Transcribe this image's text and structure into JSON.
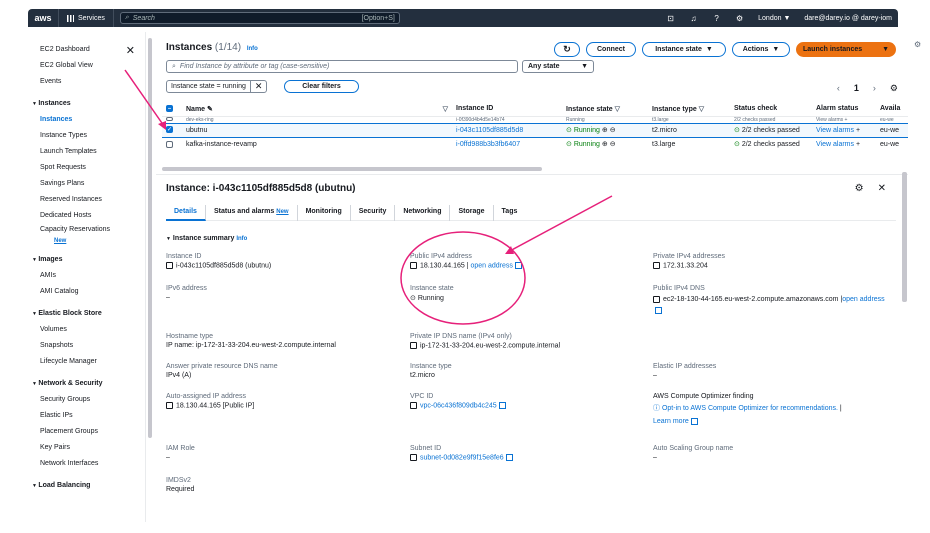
{
  "topnav": {
    "logo": "aws",
    "services_label": "Services",
    "search_placeholder": "Search",
    "search_hint": "[Option+S]",
    "region": "London ▼",
    "account": "dare@darey.io @ darey-iom"
  },
  "sidebar": {
    "top_items": [
      "EC2 Dashboard",
      "EC2 Global View",
      "Events"
    ],
    "sections": [
      {
        "title": "Instances",
        "items": [
          "Instances",
          "Instance Types",
          "Launch Templates",
          "Spot Requests",
          "Savings Plans",
          "Reserved Instances",
          "Dedicated Hosts",
          "Capacity Reservations"
        ],
        "new_label": "New"
      },
      {
        "title": "Images",
        "items": [
          "AMIs",
          "AMI Catalog"
        ]
      },
      {
        "title": "Elastic Block Store",
        "items": [
          "Volumes",
          "Snapshots",
          "Lifecycle Manager"
        ]
      },
      {
        "title": "Network & Security",
        "items": [
          "Security Groups",
          "Elastic IPs",
          "Placement Groups",
          "Key Pairs",
          "Network Interfaces"
        ]
      },
      {
        "title": "Load Balancing",
        "items": []
      }
    ]
  },
  "instances": {
    "title": "Instances",
    "count": "(1/14)",
    "info": "Info",
    "connect": "Connect",
    "instance_state": "Instance state",
    "actions": "Actions",
    "launch": "Launch instances",
    "filter_placeholder": "Find Instance by attribute or tag (case-sensitive)",
    "any_state": "Any state",
    "token": "Instance state = running",
    "clear_filters": "Clear filters",
    "page": "1",
    "columns": [
      "Name",
      "Instance ID",
      "Instance state",
      "Instance type",
      "Status check",
      "Alarm status",
      "Availa"
    ],
    "partial_row": [
      "dev-eks-ring",
      "i-0f390d4b4d5e14b74",
      "Running",
      "t3.large",
      "2/2 checks passed",
      "View alarms +",
      "eu-we"
    ],
    "rows": [
      {
        "name": "ubutnu",
        "id": "i-043c1105df885d5d8",
        "state": "Running",
        "type": "t2.micro",
        "status": "2/2 checks passed",
        "alarm": "View alarms",
        "az": "eu-we"
      },
      {
        "name": "kafka-instance-revamp",
        "id": "i-0ffd988b3b3fb6407",
        "state": "Running",
        "type": "t3.large",
        "status": "2/2 checks passed",
        "alarm": "View alarms",
        "az": "eu-we"
      }
    ]
  },
  "detail": {
    "title": "Instance: i-043c1105df885d5d8 (ubutnu)",
    "tabs": [
      "Details",
      "Status and alarms",
      "Monitoring",
      "Security",
      "Networking",
      "Storage",
      "Tags"
    ],
    "tab_new": "New",
    "summary": "Instance summary",
    "summary_info": "Info",
    "instance_id_label": "Instance ID",
    "instance_id_value": "i-043c1105df885d5d8 (ubutnu)",
    "ipv6_label": "IPv6 address",
    "ipv6_value": "–",
    "hostname_type_label": "Hostname type",
    "hostname_type_value": "IP name: ip-172-31-33-204.eu-west-2.compute.internal",
    "answer_dns_label": "Answer private resource DNS name",
    "answer_dns_value": "IPv4 (A)",
    "auto_ip_label": "Auto-assigned IP address",
    "auto_ip_value": "18.130.44.165 [Public IP]",
    "iam_label": "IAM Role",
    "iam_value": "–",
    "imds_label": "IMDSv2",
    "imds_value": "Required",
    "public_ip_label": "Public IPv4 address",
    "public_ip_value": "18.130.44.165",
    "open_address": "open address",
    "state_label": "Instance state",
    "state_value": "Running",
    "private_dns_label": "Private IP DNS name (IPv4 only)",
    "private_dns_value": "ip-172-31-33-204.eu-west-2.compute.internal",
    "type_label": "Instance type",
    "type_value": "t2.micro",
    "vpc_label": "VPC ID",
    "vpc_value": "vpc-06c436f809db4c245",
    "subnet_label": "Subnet ID",
    "subnet_value": "subnet-0d082e9f9f15e8fe6",
    "private_ip_label": "Private IPv4 addresses",
    "private_ip_value": "172.31.33.204",
    "public_dns_label": "Public IPv4 DNS",
    "public_dns_value": "ec2-18-130-44-165.eu-west-2.compute.amazonaws.com",
    "public_dns_open": "open address",
    "eip_label": "Elastic IP addresses",
    "eip_value": "–",
    "optimizer_label": "AWS Compute Optimizer finding",
    "optimizer_value": "Opt-in to AWS Compute Optimizer for recommendations.",
    "learn_more": "Learn more",
    "asg_label": "Auto Scaling Group name",
    "asg_value": "–"
  },
  "colors": {
    "accent": "#0972d3",
    "primary": "#ec7211",
    "nav": "#232f3e",
    "annotation": "#e6207a",
    "running": "#037f0c"
  }
}
